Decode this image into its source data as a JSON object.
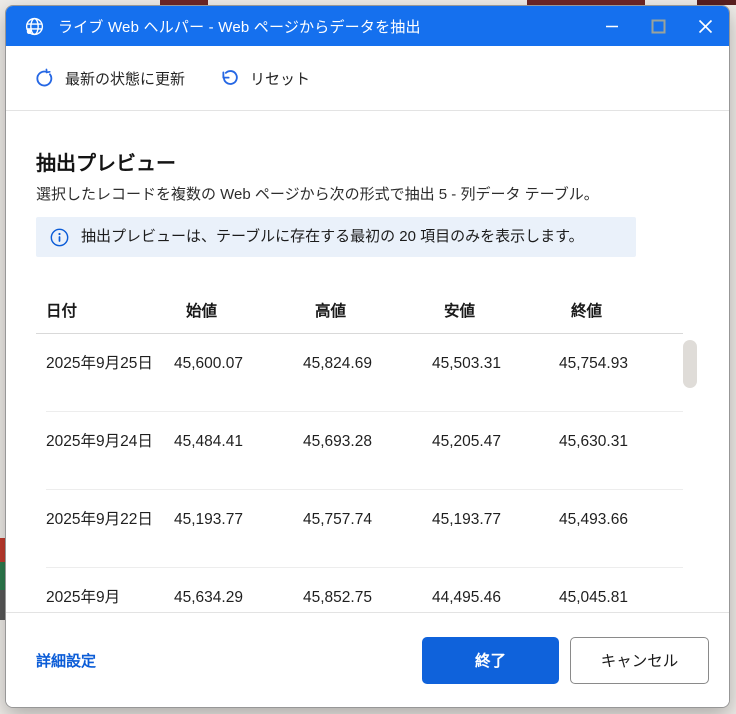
{
  "colors": {
    "titlebar_blue": "#1570EE",
    "accent_blue": "#0F62DB",
    "link_blue": "#0B5CD7",
    "toolbar_icon_blue": "#2567E4",
    "banner_bg": "#EAF1FA"
  },
  "window": {
    "title": "ライブ Web ヘルパー - Web ページからデータを抽出"
  },
  "toolbar": {
    "refresh_label": "最新の状態に更新",
    "reset_label": "リセット"
  },
  "main": {
    "heading": "抽出プレビュー",
    "description": "選択したレコードを複数の Web ページから次の形式で抽出 5 - 列データ テーブル。",
    "info_banner": "抽出プレビューは、テーブルに存在する最初の 20 項目のみを表示します。"
  },
  "table": {
    "headers": [
      "日付",
      "始値",
      "高値",
      "安値",
      "終値"
    ],
    "rows": [
      {
        "date": "2025年9月25日",
        "open": "45,600.07",
        "high": "45,824.69",
        "low": "45,503.31",
        "close": "45,754.93"
      },
      {
        "date": "2025年9月24日",
        "open": "45,484.41",
        "high": "45,693.28",
        "low": "45,205.47",
        "close": "45,630.31"
      },
      {
        "date": "2025年9月22日",
        "open": "45,193.77",
        "high": "45,757.74",
        "low": "45,193.77",
        "close": "45,493.66"
      },
      {
        "date": "2025年9月",
        "open": "45,634.29",
        "high": "45,852.75",
        "low": "44,495.46",
        "close": "45,045.81"
      }
    ]
  },
  "footer": {
    "advanced_label": "詳細設定",
    "finish_label": "終了",
    "cancel_label": "キャンセル"
  }
}
